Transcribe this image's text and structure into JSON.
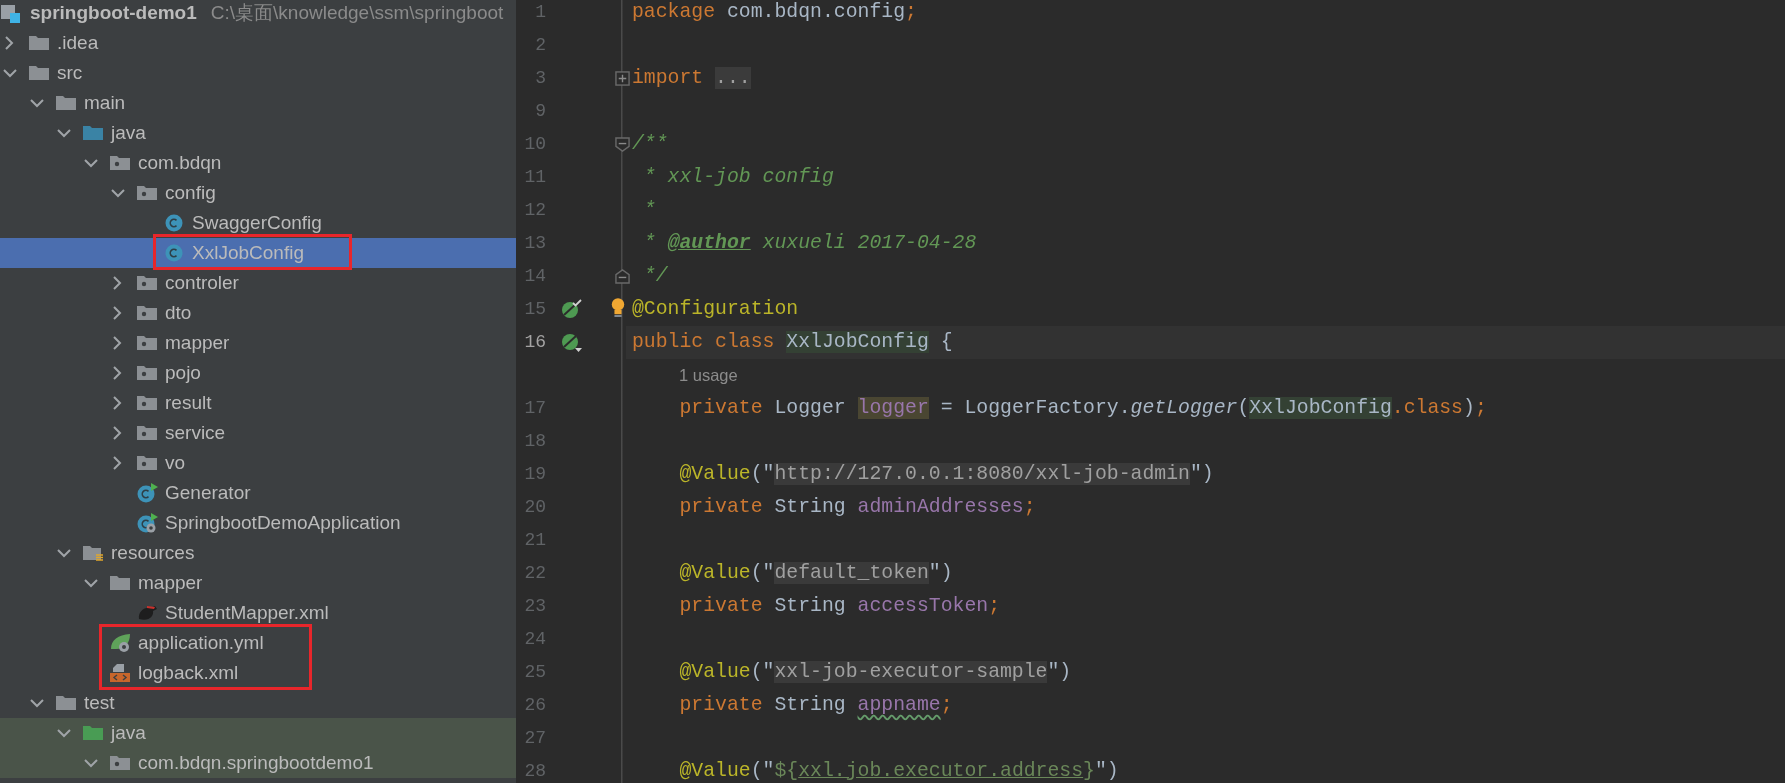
{
  "project": {
    "name": "springboot-demo1",
    "path": "C:\\桌面\\knowledge\\ssm\\springboot"
  },
  "tree": [
    {
      "label": ".idea",
      "kind": "folder",
      "expanded": false,
      "selected": false,
      "boxed": false,
      "tinted": false
    },
    {
      "label": "src",
      "kind": "folder",
      "expanded": true,
      "selected": false,
      "boxed": false,
      "tinted": false,
      "children": [
        {
          "label": "main",
          "kind": "folder",
          "expanded": true,
          "selected": false,
          "boxed": false,
          "tinted": false,
          "children": [
            {
              "label": "java",
              "kind": "source-folder",
              "expanded": true,
              "selected": false,
              "boxed": false,
              "tinted": false,
              "children": [
                {
                  "label": "com.bdqn",
                  "kind": "package",
                  "expanded": true,
                  "selected": false,
                  "boxed": false,
                  "tinted": false,
                  "children": [
                    {
                      "label": "config",
                      "kind": "package",
                      "expanded": true,
                      "selected": false,
                      "boxed": false,
                      "tinted": false,
                      "children": [
                        {
                          "label": "SwaggerConfig",
                          "kind": "class",
                          "selected": false,
                          "boxed": false,
                          "tinted": false
                        },
                        {
                          "label": "XxlJobConfig",
                          "kind": "class",
                          "selected": true,
                          "boxed": true,
                          "tinted": false
                        }
                      ]
                    },
                    {
                      "label": "controler",
                      "kind": "package",
                      "expanded": false,
                      "selected": false,
                      "boxed": false,
                      "tinted": false
                    },
                    {
                      "label": "dto",
                      "kind": "package",
                      "expanded": false,
                      "selected": false,
                      "boxed": false,
                      "tinted": false
                    },
                    {
                      "label": "mapper",
                      "kind": "package",
                      "expanded": false,
                      "selected": false,
                      "boxed": false,
                      "tinted": false
                    },
                    {
                      "label": "pojo",
                      "kind": "package",
                      "expanded": false,
                      "selected": false,
                      "boxed": false,
                      "tinted": false
                    },
                    {
                      "label": "result",
                      "kind": "package",
                      "expanded": false,
                      "selected": false,
                      "boxed": false,
                      "tinted": false
                    },
                    {
                      "label": "service",
                      "kind": "package",
                      "expanded": false,
                      "selected": false,
                      "boxed": false,
                      "tinted": false
                    },
                    {
                      "label": "vo",
                      "kind": "package",
                      "expanded": false,
                      "selected": false,
                      "boxed": false,
                      "tinted": false
                    },
                    {
                      "label": "Generator",
                      "kind": "runnable-class",
                      "selected": false,
                      "boxed": false,
                      "tinted": false
                    },
                    {
                      "label": "SpringbootDemoApplication",
                      "kind": "spring-app",
                      "selected": false,
                      "boxed": false,
                      "tinted": false
                    }
                  ]
                }
              ]
            },
            {
              "label": "resources",
              "kind": "resources-folder",
              "expanded": true,
              "selected": false,
              "boxed": false,
              "tinted": false,
              "children": [
                {
                  "label": "mapper",
                  "kind": "folder",
                  "expanded": true,
                  "selected": false,
                  "boxed": false,
                  "tinted": false,
                  "children": [
                    {
                      "label": "StudentMapper.xml",
                      "kind": "mybatis-xml",
                      "selected": false,
                      "boxed": false,
                      "tinted": false
                    }
                  ]
                },
                {
                  "label": "application.yml",
                  "kind": "spring-yml",
                  "selected": false,
                  "boxed": true,
                  "tinted": false
                },
                {
                  "label": "logback.xml",
                  "kind": "xml",
                  "selected": false,
                  "boxed": true,
                  "tinted": false
                }
              ]
            }
          ]
        },
        {
          "label": "test",
          "kind": "folder",
          "expanded": true,
          "selected": false,
          "boxed": false,
          "tinted": false,
          "children": [
            {
              "label": "java",
              "kind": "test-folder",
              "expanded": true,
              "selected": false,
              "boxed": false,
              "tinted": true,
              "children": [
                {
                  "label": "com.bdqn.springbootdemo1",
                  "kind": "package",
                  "expanded": true,
                  "selected": false,
                  "boxed": false,
                  "tinted": true
                }
              ]
            }
          ]
        }
      ]
    }
  ],
  "editor": {
    "lines": [
      {
        "kind": "code",
        "number": "1",
        "current": false,
        "tokens": [
          {
            "kind": "keyword",
            "text": "package"
          },
          {
            "kind": "plain",
            "text": " com.bdqn.config"
          },
          {
            "kind": "keyword",
            "text": ";"
          }
        ]
      },
      {
        "kind": "code",
        "number": "2",
        "current": false
      },
      {
        "kind": "code",
        "number": "3",
        "current": false,
        "fold_marker": {
          "kind": "plus"
        },
        "tokens": [
          {
            "kind": "keyword",
            "text": "import"
          },
          {
            "kind": "folded",
            "text": "..."
          }
        ]
      },
      {
        "kind": "code",
        "number": "9",
        "current": false
      },
      {
        "kind": "code",
        "number": "10",
        "current": false,
        "fold_marker": {
          "kind": "open"
        },
        "tokens": [
          {
            "kind": "doc",
            "text": "/**"
          }
        ]
      },
      {
        "kind": "code",
        "number": "11",
        "current": false,
        "tokens": [
          {
            "kind": "doc",
            "text": " * xxl-job config"
          }
        ]
      },
      {
        "kind": "code",
        "number": "12",
        "current": false,
        "tokens": [
          {
            "kind": "doc",
            "text": " *"
          }
        ]
      },
      {
        "kind": "code",
        "number": "13",
        "current": false,
        "tokens": [
          {
            "kind": "doc",
            "text": " * "
          },
          {
            "kind": "doc-tag",
            "text": "@author"
          },
          {
            "kind": "doc",
            "text": " xuxueli 2017-04-28"
          }
        ]
      },
      {
        "kind": "code",
        "number": "14",
        "current": false,
        "fold_marker": {
          "kind": "close"
        },
        "tokens": [
          {
            "kind": "doc",
            "text": " */"
          }
        ]
      },
      {
        "kind": "code",
        "number": "15",
        "current": false,
        "gutter_icon": {
          "kind": "bean-check"
        },
        "intention": true,
        "tokens": [
          {
            "kind": "annotation",
            "text": "@Configuration"
          }
        ]
      },
      {
        "kind": "code",
        "number": "16",
        "current": true,
        "gutter_icon": {
          "kind": "bean-down"
        },
        "tokens": [
          {
            "kind": "keyword",
            "text": "public class "
          },
          {
            "kind": "class-ref",
            "text": "XxlJobConfig"
          },
          {
            "kind": "plain",
            "text": " {"
          }
        ]
      },
      {
        "kind": "hint",
        "text": "1 usage"
      },
      {
        "kind": "code",
        "number": "17",
        "current": false,
        "indented": true,
        "tokens": [
          {
            "kind": "keyword",
            "text": "private"
          },
          {
            "kind": "plain",
            "text": " Logger "
          },
          {
            "kind": "unused-field",
            "text": "logger"
          },
          {
            "kind": "plain",
            "text": " = LoggerFactory."
          },
          {
            "kind": "method",
            "text": "getLogger"
          },
          {
            "kind": "plain",
            "text": "("
          },
          {
            "kind": "class-ref",
            "text": "XxlJobConfig"
          },
          {
            "kind": "keyword",
            "text": ".class"
          },
          {
            "kind": "plain",
            "text": ")"
          },
          {
            "kind": "keyword",
            "text": ";"
          }
        ]
      },
      {
        "kind": "code",
        "number": "18",
        "current": false
      },
      {
        "kind": "code",
        "number": "19",
        "current": false,
        "indented": true,
        "tokens": [
          {
            "kind": "annotation",
            "text": "@Value"
          },
          {
            "kind": "plain",
            "text": "(\""
          },
          {
            "kind": "value",
            "text": "http://127.0.0.1:8080/xxl-job-admin"
          },
          {
            "kind": "plain",
            "text": "\")"
          }
        ]
      },
      {
        "kind": "code",
        "number": "20",
        "current": false,
        "indented": true,
        "tokens": [
          {
            "kind": "keyword",
            "text": "private"
          },
          {
            "kind": "plain",
            "text": " String "
          },
          {
            "kind": "field",
            "text": "adminAddresses"
          },
          {
            "kind": "keyword",
            "text": ";"
          }
        ]
      },
      {
        "kind": "code",
        "number": "21",
        "current": false
      },
      {
        "kind": "code",
        "number": "22",
        "current": false,
        "indented": true,
        "tokens": [
          {
            "kind": "annotation",
            "text": "@Value"
          },
          {
            "kind": "plain",
            "text": "(\""
          },
          {
            "kind": "value",
            "text": "default_token"
          },
          {
            "kind": "plain",
            "text": "\")"
          }
        ]
      },
      {
        "kind": "code",
        "number": "23",
        "current": false,
        "indented": true,
        "tokens": [
          {
            "kind": "keyword",
            "text": "private"
          },
          {
            "kind": "plain",
            "text": " String "
          },
          {
            "kind": "field",
            "text": "accessToken"
          },
          {
            "kind": "keyword",
            "text": ";"
          }
        ]
      },
      {
        "kind": "code",
        "number": "24",
        "current": false
      },
      {
        "kind": "code",
        "number": "25",
        "current": false,
        "indented": true,
        "tokens": [
          {
            "kind": "annotation",
            "text": "@Value"
          },
          {
            "kind": "plain",
            "text": "(\""
          },
          {
            "kind": "value",
            "text": "xxl-job-executor-sample"
          },
          {
            "kind": "plain",
            "text": "\")"
          }
        ]
      },
      {
        "kind": "code",
        "number": "26",
        "current": false,
        "indented": true,
        "tokens": [
          {
            "kind": "keyword",
            "text": "private"
          },
          {
            "kind": "plain",
            "text": " String "
          },
          {
            "kind": "typo-field",
            "text": "appname"
          },
          {
            "kind": "keyword",
            "text": ";"
          }
        ]
      },
      {
        "kind": "code",
        "number": "27",
        "current": false
      },
      {
        "kind": "code",
        "number": "28",
        "current": false,
        "indented": true,
        "tokens": [
          {
            "kind": "annotation",
            "text": "@Value"
          },
          {
            "kind": "plain",
            "text": "(\""
          },
          {
            "kind": "string",
            "text": "${"
          },
          {
            "kind": "property",
            "text": "xxl.job.executor.address"
          },
          {
            "kind": "string",
            "text": "}"
          },
          {
            "kind": "plain",
            "text": "\")"
          }
        ]
      }
    ]
  }
}
